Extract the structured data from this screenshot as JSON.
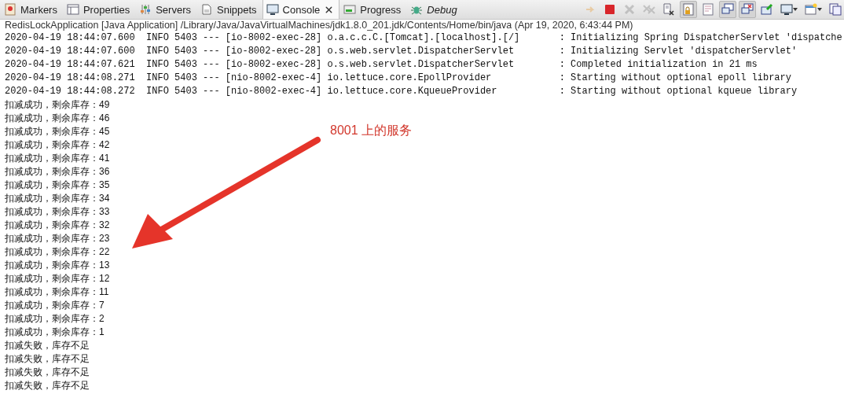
{
  "tabs": [
    {
      "kind": "markers",
      "label": "Markers",
      "selected": false,
      "italic": false,
      "closable": false
    },
    {
      "kind": "properties",
      "label": "Properties",
      "selected": false,
      "italic": false,
      "closable": false
    },
    {
      "kind": "servers",
      "label": "Servers",
      "selected": false,
      "italic": false,
      "closable": false
    },
    {
      "kind": "snippets",
      "label": "Snippets",
      "selected": false,
      "italic": false,
      "closable": false
    },
    {
      "kind": "console",
      "label": "Console",
      "selected": true,
      "italic": false,
      "closable": true
    },
    {
      "kind": "progress",
      "label": "Progress",
      "selected": false,
      "italic": false,
      "closable": false
    },
    {
      "kind": "debug",
      "label": "Debug",
      "selected": false,
      "italic": true,
      "closable": false
    }
  ],
  "toolbar": [
    {
      "kind": "relaunch",
      "disabled": true,
      "pressed": false,
      "dropdown": false
    },
    {
      "kind": "stop",
      "disabled": false,
      "pressed": false,
      "dropdown": false
    },
    {
      "kind": "remove",
      "disabled": true,
      "pressed": false,
      "dropdown": false
    },
    {
      "kind": "remove-all",
      "disabled": true,
      "pressed": false,
      "dropdown": false
    },
    {
      "kind": "clear",
      "disabled": false,
      "pressed": false,
      "dropdown": false
    },
    {
      "kind": "scroll-lock",
      "disabled": false,
      "pressed": true,
      "dropdown": false
    },
    {
      "kind": "word-wrap",
      "disabled": false,
      "pressed": false,
      "dropdown": false
    },
    {
      "kind": "show-out",
      "disabled": false,
      "pressed": true,
      "dropdown": false
    },
    {
      "kind": "show-err",
      "disabled": false,
      "pressed": true,
      "dropdown": false
    },
    {
      "kind": "pin",
      "disabled": false,
      "pressed": false,
      "dropdown": false
    },
    {
      "kind": "display",
      "disabled": false,
      "pressed": false,
      "dropdown": true
    },
    {
      "kind": "new-console",
      "disabled": false,
      "pressed": false,
      "dropdown": true
    },
    {
      "kind": "copy",
      "disabled": false,
      "pressed": false,
      "dropdown": false
    }
  ],
  "console": {
    "title": "RedisLockApplication [Java Application] /Library/Java/JavaVirtualMachines/jdk1.8.0_201.jdk/Contents/Home/bin/java (Apr 19, 2020, 6:43:44 PM)",
    "log_lines": [
      "2020-04-19 18:44:07.600  INFO 5403 --- [io-8002-exec-28] o.a.c.c.C.[Tomcat].[localhost].[/]       : Initializing Spring DispatcherServlet 'dispatche",
      "2020-04-19 18:44:07.600  INFO 5403 --- [io-8002-exec-28] o.s.web.servlet.DispatcherServlet        : Initializing Servlet 'dispatcherServlet'",
      "2020-04-19 18:44:07.621  INFO 5403 --- [io-8002-exec-28] o.s.web.servlet.DispatcherServlet        : Completed initialization in 21 ms",
      "2020-04-19 18:44:08.271  INFO 5403 --- [nio-8002-exec-4] io.lettuce.core.EpollProvider            : Starting without optional epoll library",
      "2020-04-19 18:44:08.272  INFO 5403 --- [nio-8002-exec-4] io.lettuce.core.KqueueProvider           : Starting without optional kqueue library"
    ],
    "output_lines": [
      "扣减成功，剩余库存：49",
      "扣减成功，剩余库存：46",
      "扣减成功，剩余库存：45",
      "扣减成功，剩余库存：42",
      "扣减成功，剩余库存：41",
      "扣减成功，剩余库存：36",
      "扣减成功，剩余库存：35",
      "扣减成功，剩余库存：34",
      "扣减成功，剩余库存：33",
      "扣减成功，剩余库存：32",
      "扣减成功，剩余库存：23",
      "扣减成功，剩余库存：22",
      "扣减成功，剩余库存：13",
      "扣减成功，剩余库存：12",
      "扣减成功，剩余库存：11",
      "扣减成功，剩余库存：7",
      "扣减成功，剩余库存：2",
      "扣减成功，剩余库存：1",
      "扣减失败，库存不足",
      "扣减失败，库存不足",
      "扣减失败，库存不足",
      "扣减失败，库存不足"
    ]
  },
  "annotation": {
    "text": "8001 上的服务"
  }
}
